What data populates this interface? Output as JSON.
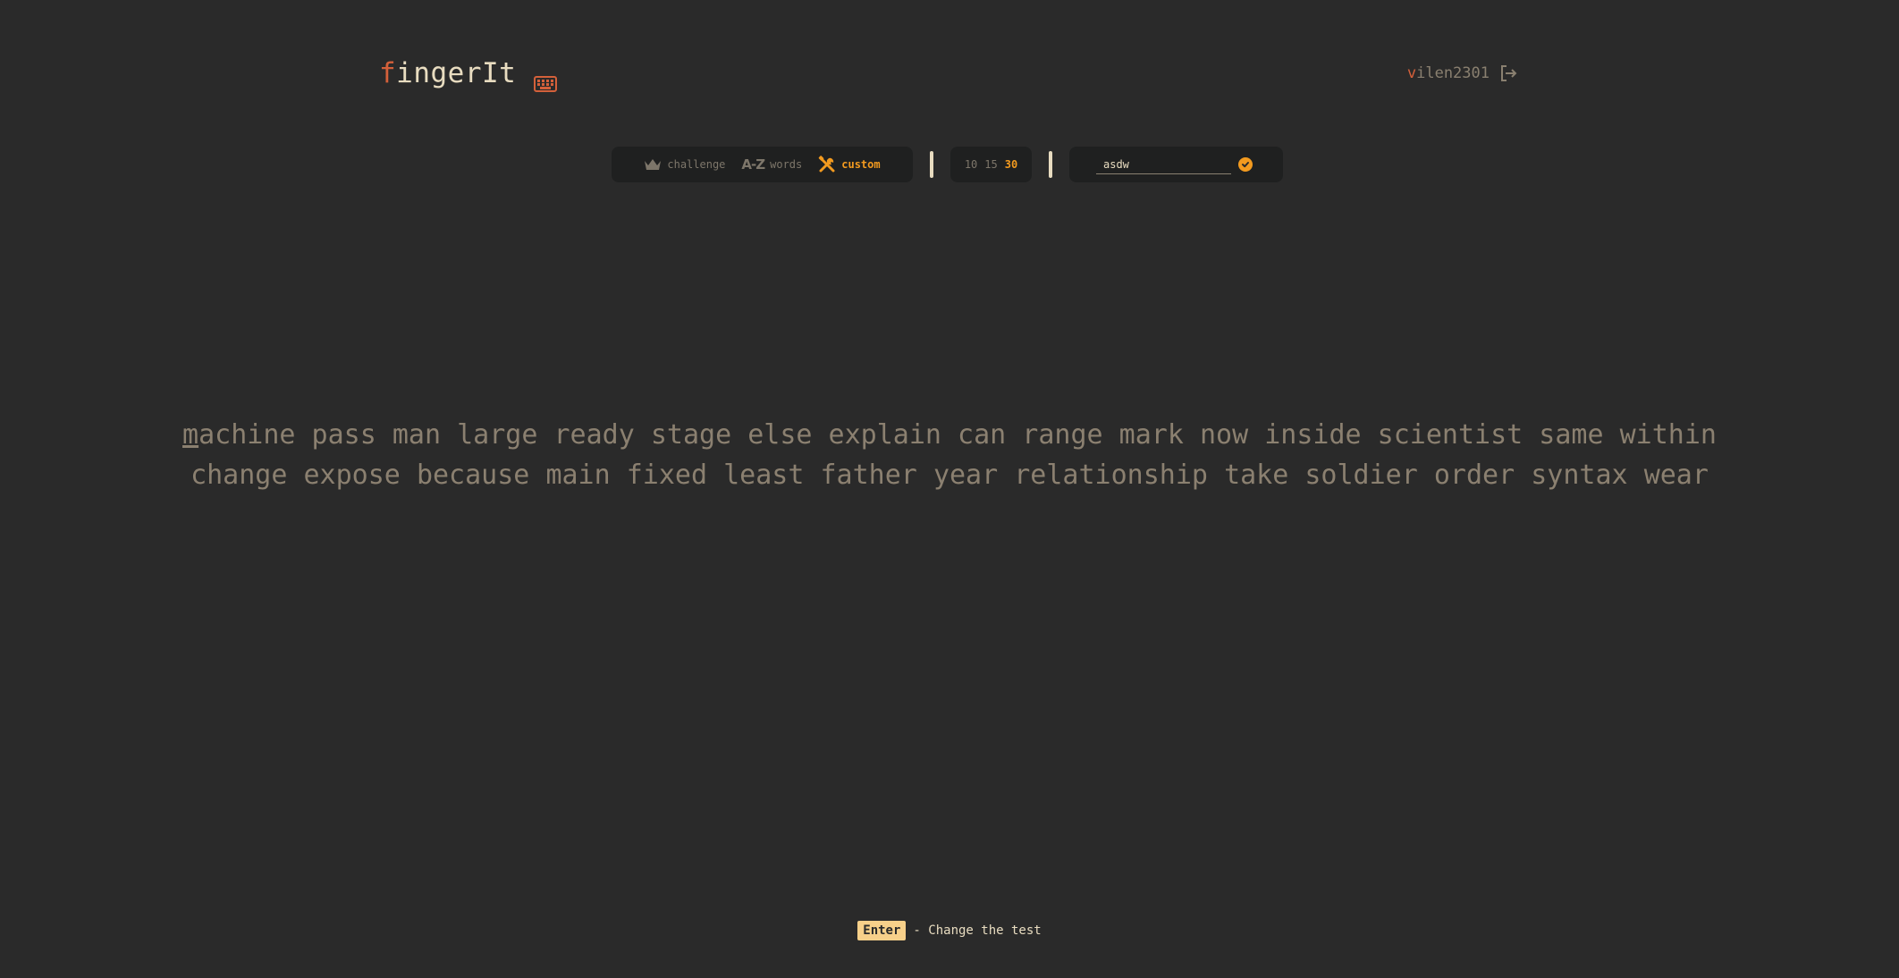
{
  "header": {
    "logo_first": "f",
    "logo_rest": "ingerIt",
    "user_first": "v",
    "user_rest": "ilen2301"
  },
  "modes": [
    {
      "label": "challenge",
      "icon": "crown-icon",
      "active": false
    },
    {
      "label": "words",
      "icon": "a-z-icon",
      "active": false
    },
    {
      "label": "custom",
      "icon": "tools-icon",
      "active": true
    }
  ],
  "az_icon_text": "A-Z",
  "times": [
    {
      "label": "10",
      "active": false
    },
    {
      "label": "15",
      "active": false
    },
    {
      "label": "30",
      "active": true
    }
  ],
  "custom": {
    "value": "asdw"
  },
  "test": {
    "first_char": "m",
    "first_rest": "achine",
    "words": [
      "pass",
      "man",
      "large",
      "ready",
      "stage",
      "else",
      "explain",
      "can",
      "range",
      "mark",
      "now",
      "inside",
      "scientist",
      "same",
      "within",
      "change",
      "expose",
      "because",
      "main",
      "fixed",
      "least",
      "father",
      "year",
      "relationship",
      "take",
      "soldier",
      "order",
      "syntax",
      "wear"
    ]
  },
  "hint": {
    "key": "Enter",
    "text": "- Change the test"
  },
  "colors": {
    "background": "#2a2a2a",
    "accent": "#f29a1f",
    "logo_accent": "#d4603a",
    "text": "#e8dcc0",
    "muted": "#8b8070"
  }
}
